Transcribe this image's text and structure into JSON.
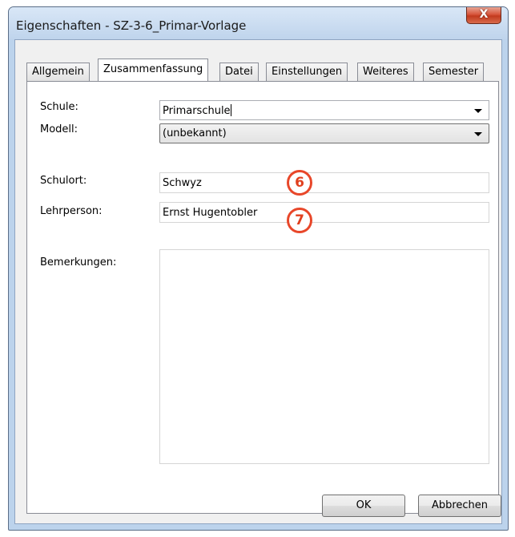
{
  "window": {
    "title": "Eigenschaften - SZ-3-6_Primar-Vorlage",
    "close_label": "X"
  },
  "tabs": [
    "Allgemein",
    "Zusammenfassung",
    "Datei",
    "Einstellungen",
    "Weiteres",
    "Semester"
  ],
  "active_tab": "Zusammenfassung",
  "form": {
    "schule": {
      "label": "Schule:",
      "value": "Primarschule"
    },
    "modell": {
      "label": "Modell:",
      "value": "(unbekannt)"
    },
    "schulort": {
      "label": "Schulort:",
      "value": "Schwyz"
    },
    "lehrperson": {
      "label": "Lehrperson:",
      "value": "Ernst Hugentobler"
    },
    "bemerkungen": {
      "label": "Bemerkungen:",
      "value": ""
    }
  },
  "annotations": {
    "schulort_badge": "6",
    "lehrperson_badge": "7"
  },
  "buttons": {
    "ok": "OK",
    "cancel": "Abbrechen"
  },
  "colors": {
    "badge": "#e8472a",
    "close_button": "#c23a1e",
    "title_bar": "#bfd4ec"
  }
}
